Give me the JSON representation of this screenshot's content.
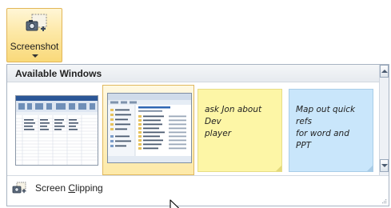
{
  "ribbon": {
    "screenshot_label": "Screenshot"
  },
  "dropdown": {
    "header_title": "Available Windows",
    "windows": [
      {
        "kind": "spreadsheet-window"
      },
      {
        "kind": "explorer-window",
        "hovered": true
      }
    ],
    "notes": [
      {
        "color": "#fdf6a6",
        "text_line1": "ask Jon about Dev",
        "text_line2": "player"
      },
      {
        "color": "#c9e6fb",
        "text_line1": "Map out quick refs",
        "text_line2": "for word and PPT"
      }
    ],
    "clipping": {
      "label_before": "Screen ",
      "label_accel": "C",
      "label_after": "lipping"
    }
  },
  "colors": {
    "hover_fill": "#fde9a8",
    "hover_border": "#e0b85e",
    "yellow_note": "#fdf6a6",
    "blue_note": "#c9e6fb"
  }
}
